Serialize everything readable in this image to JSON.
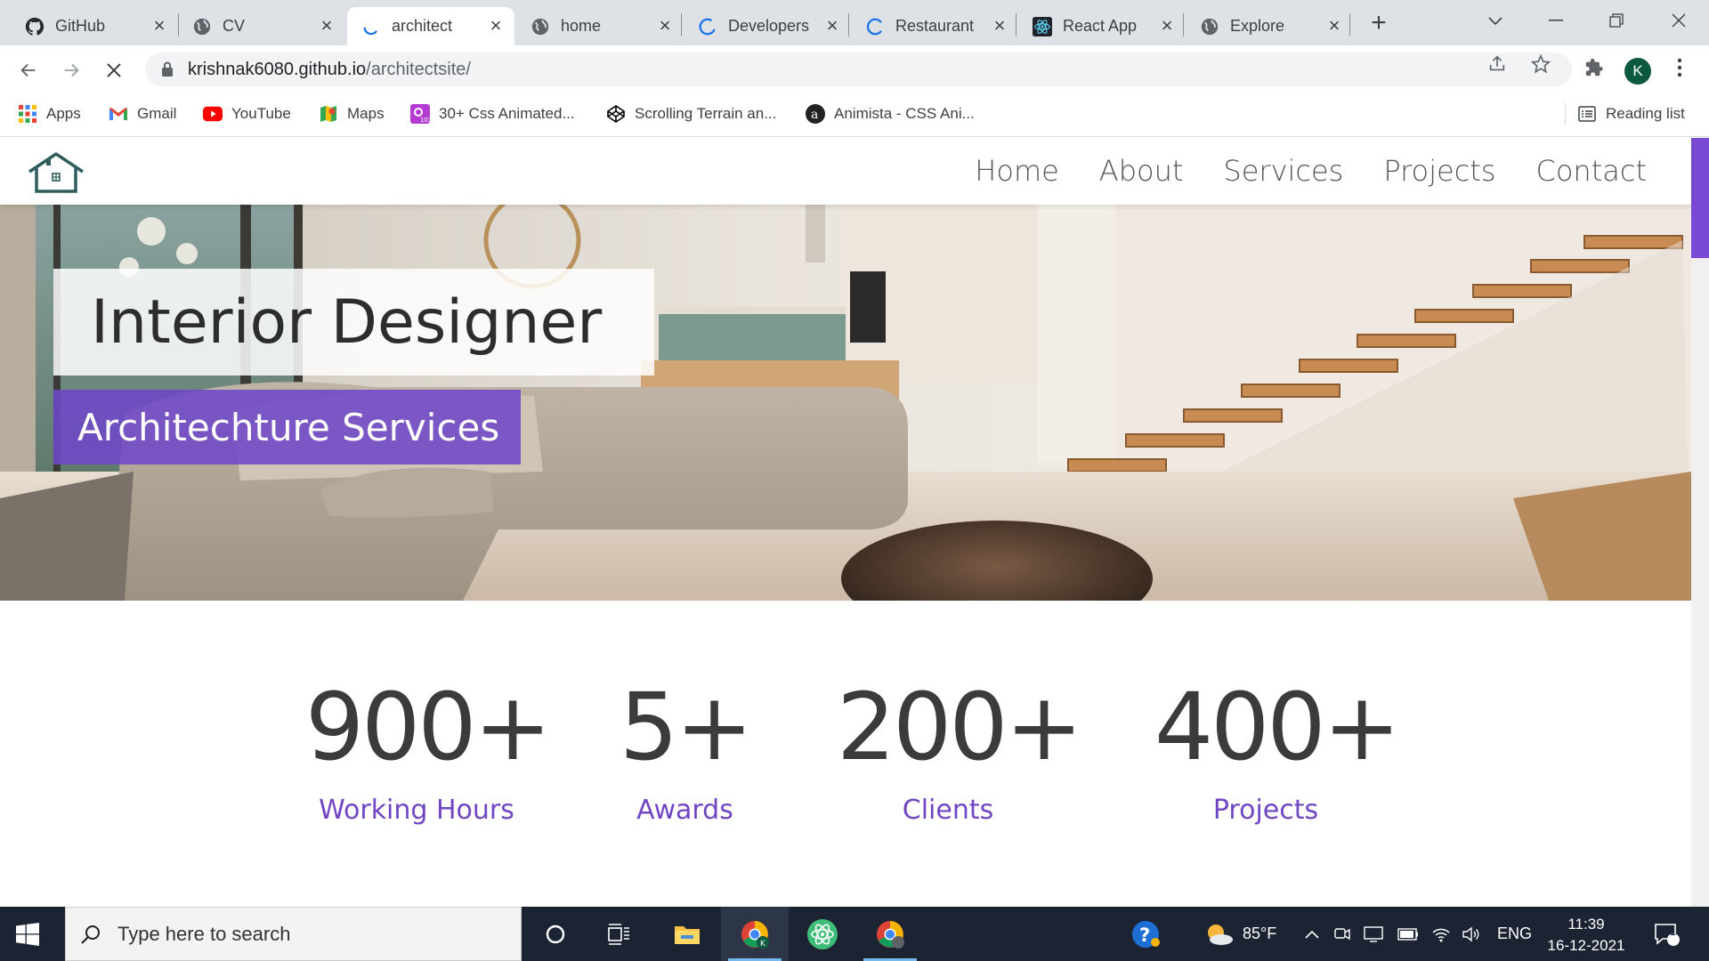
{
  "browser": {
    "tabs": [
      {
        "title": "GitHub",
        "icon": "github-icon"
      },
      {
        "title": "CV",
        "icon": "globe-icon"
      },
      {
        "title": "architect",
        "icon": "loading-spinner-icon",
        "active": true
      },
      {
        "title": "home",
        "icon": "globe-icon"
      },
      {
        "title": "Developers",
        "icon": "loading-spinner-icon"
      },
      {
        "title": "Restaurant",
        "icon": "loading-spinner-icon"
      },
      {
        "title": "React App",
        "icon": "react-icon"
      },
      {
        "title": "Explore",
        "icon": "globe-icon"
      }
    ],
    "url_host": "krishnak6080.github.io",
    "url_path": "/architectsite/",
    "profile_initial": "K",
    "bookmarks": [
      {
        "label": "Apps",
        "icon": "apps-grid-icon"
      },
      {
        "label": "Gmail",
        "icon": "gmail-icon"
      },
      {
        "label": "YouTube",
        "icon": "youtube-icon"
      },
      {
        "label": "Maps",
        "icon": "maps-icon"
      },
      {
        "label": "30+ Css Animated...",
        "icon": "css-bookmark-icon"
      },
      {
        "label": "Scrolling Terrain an...",
        "icon": "codepen-icon"
      },
      {
        "label": "Animista - CSS Ani...",
        "icon": "animista-icon"
      }
    ],
    "reading_list": "Reading list"
  },
  "site": {
    "nav": [
      "Home",
      "About",
      "Services",
      "Projects",
      "Contact"
    ],
    "hero_title": "Interior Designer",
    "hero_subtitle": "Architechture Services",
    "stats": [
      {
        "value": "900+",
        "label": "Working Hours"
      },
      {
        "value": "5+",
        "label": "Awards"
      },
      {
        "value": "200+",
        "label": "Clients"
      },
      {
        "value": "400+",
        "label": "Projects"
      }
    ],
    "accent_color": "#7046c2"
  },
  "taskbar": {
    "search_placeholder": "Type here to search",
    "weather": "85°F",
    "language": "ENG",
    "time": "11:39",
    "date": "16-12-2021",
    "notification_count": "1"
  }
}
